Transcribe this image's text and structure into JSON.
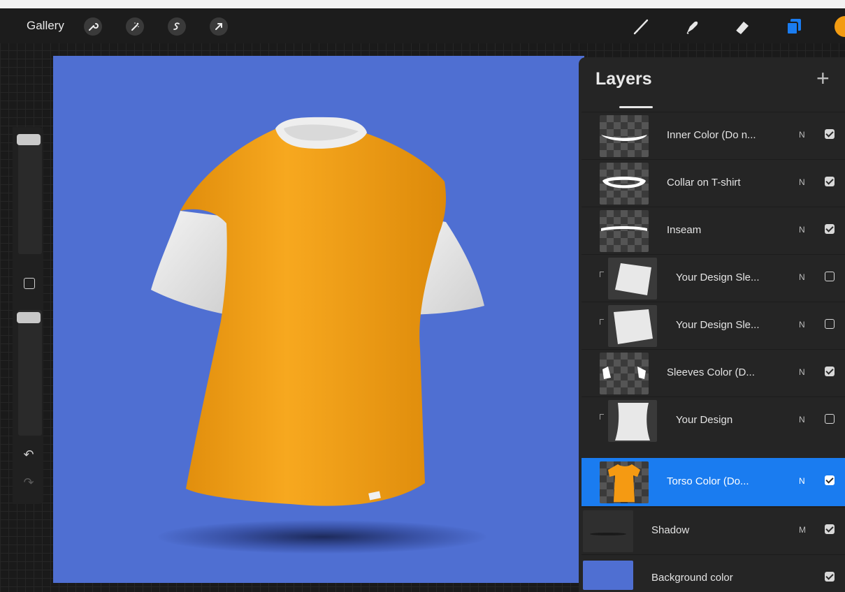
{
  "topbar": {
    "gallery_label": "Gallery",
    "left_tools": [
      "wrench-icon",
      "magic-wand-icon",
      "selection-icon",
      "transform-arrow-icon"
    ],
    "right_tools": [
      "brush-icon",
      "smudge-icon",
      "eraser-icon",
      "layers-icon"
    ],
    "current_color": "#f39c12"
  },
  "canvas": {
    "background_color": "#4f6fd2",
    "shirt_color": "#f4a11a",
    "sleeve_color": "#ececec"
  },
  "layers_panel": {
    "title": "Layers",
    "add_label": "+",
    "layers": [
      {
        "name": "Inner Color (Do n...",
        "mode": "N",
        "visible": true,
        "clipped": false,
        "selected": false
      },
      {
        "name": "Collar on T-shirt",
        "mode": "N",
        "visible": true,
        "clipped": false,
        "selected": false
      },
      {
        "name": "Inseam",
        "mode": "N",
        "visible": true,
        "clipped": false,
        "selected": false
      },
      {
        "name": "Your Design Sle...",
        "mode": "N",
        "visible": false,
        "clipped": true,
        "selected": false
      },
      {
        "name": "Your Design Sle...",
        "mode": "N",
        "visible": false,
        "clipped": true,
        "selected": false
      },
      {
        "name": "Sleeves Color (D...",
        "mode": "N",
        "visible": true,
        "clipped": false,
        "selected": false
      },
      {
        "name": "Your Design",
        "mode": "N",
        "visible": false,
        "clipped": true,
        "selected": false
      },
      {
        "name": "Torso Color (Do...",
        "mode": "N",
        "visible": true,
        "clipped": false,
        "selected": true
      },
      {
        "name": "Shadow",
        "mode": "M",
        "visible": true,
        "clipped": false,
        "selected": false
      },
      {
        "name": "Background color",
        "mode": "",
        "visible": true,
        "clipped": false,
        "selected": false
      }
    ]
  },
  "accent_color": "#1a7cf0"
}
